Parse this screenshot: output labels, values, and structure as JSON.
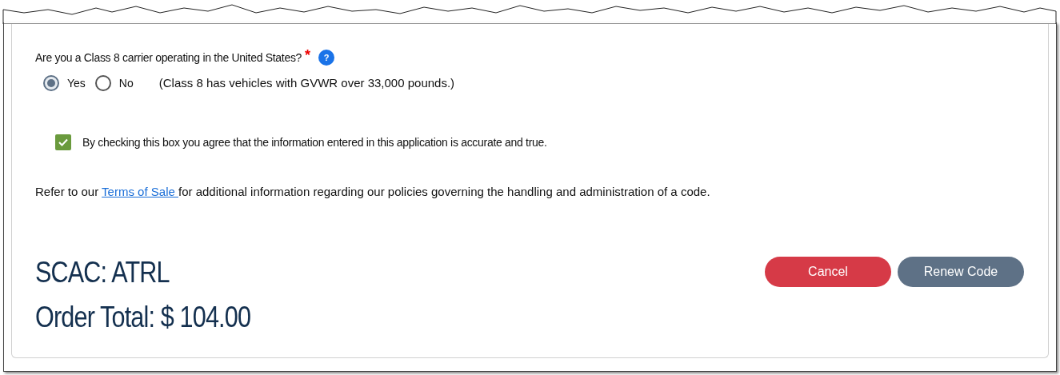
{
  "question": {
    "label": "Are you a Class 8 carrier operating in the United States?",
    "required_mark": "*",
    "help_icon": "?",
    "options": [
      {
        "label": "Yes",
        "selected": true
      },
      {
        "label": "No",
        "selected": false
      }
    ],
    "note": "(Class 8 has vehicles with GVWR over 33,000 pounds.)"
  },
  "agreement": {
    "label": "By checking this box you agree that the information entered in this application is accurate and true.",
    "checked": true
  },
  "terms": {
    "before": "Refer to our ",
    "link": "Terms of Sale ",
    "after": "for additional information regarding our policies governing the handling and administration of a code."
  },
  "scac": "SCAC: ATRL",
  "order_total": "Order Total: $ 104.00",
  "buttons": [
    {
      "label": "Cancel",
      "kind": "danger"
    },
    {
      "label": "Renew Code",
      "kind": "primary"
    }
  ]
}
